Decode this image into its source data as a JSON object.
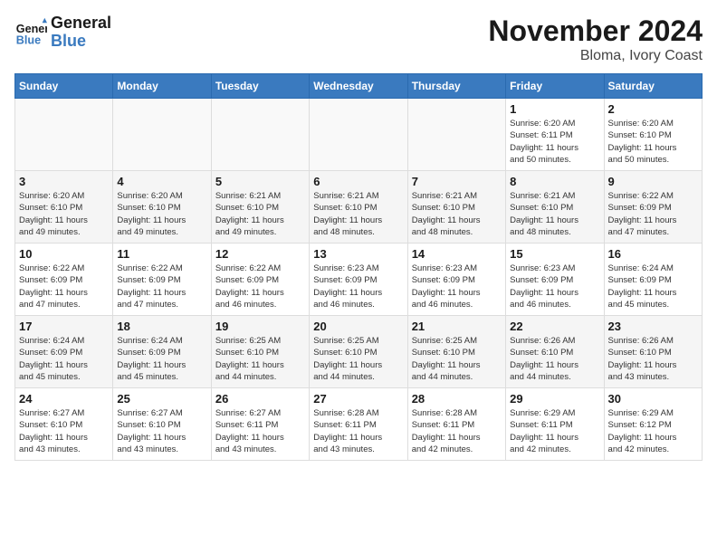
{
  "logo": {
    "text_general": "General",
    "text_blue": "Blue"
  },
  "title": "November 2024",
  "location": "Bloma, Ivory Coast",
  "weekdays": [
    "Sunday",
    "Monday",
    "Tuesday",
    "Wednesday",
    "Thursday",
    "Friday",
    "Saturday"
  ],
  "weeks": [
    [
      {
        "day": "",
        "info": ""
      },
      {
        "day": "",
        "info": ""
      },
      {
        "day": "",
        "info": ""
      },
      {
        "day": "",
        "info": ""
      },
      {
        "day": "",
        "info": ""
      },
      {
        "day": "1",
        "info": "Sunrise: 6:20 AM\nSunset: 6:11 PM\nDaylight: 11 hours\nand 50 minutes."
      },
      {
        "day": "2",
        "info": "Sunrise: 6:20 AM\nSunset: 6:10 PM\nDaylight: 11 hours\nand 50 minutes."
      }
    ],
    [
      {
        "day": "3",
        "info": "Sunrise: 6:20 AM\nSunset: 6:10 PM\nDaylight: 11 hours\nand 49 minutes."
      },
      {
        "day": "4",
        "info": "Sunrise: 6:20 AM\nSunset: 6:10 PM\nDaylight: 11 hours\nand 49 minutes."
      },
      {
        "day": "5",
        "info": "Sunrise: 6:21 AM\nSunset: 6:10 PM\nDaylight: 11 hours\nand 49 minutes."
      },
      {
        "day": "6",
        "info": "Sunrise: 6:21 AM\nSunset: 6:10 PM\nDaylight: 11 hours\nand 48 minutes."
      },
      {
        "day": "7",
        "info": "Sunrise: 6:21 AM\nSunset: 6:10 PM\nDaylight: 11 hours\nand 48 minutes."
      },
      {
        "day": "8",
        "info": "Sunrise: 6:21 AM\nSunset: 6:10 PM\nDaylight: 11 hours\nand 48 minutes."
      },
      {
        "day": "9",
        "info": "Sunrise: 6:22 AM\nSunset: 6:09 PM\nDaylight: 11 hours\nand 47 minutes."
      }
    ],
    [
      {
        "day": "10",
        "info": "Sunrise: 6:22 AM\nSunset: 6:09 PM\nDaylight: 11 hours\nand 47 minutes."
      },
      {
        "day": "11",
        "info": "Sunrise: 6:22 AM\nSunset: 6:09 PM\nDaylight: 11 hours\nand 47 minutes."
      },
      {
        "day": "12",
        "info": "Sunrise: 6:22 AM\nSunset: 6:09 PM\nDaylight: 11 hours\nand 46 minutes."
      },
      {
        "day": "13",
        "info": "Sunrise: 6:23 AM\nSunset: 6:09 PM\nDaylight: 11 hours\nand 46 minutes."
      },
      {
        "day": "14",
        "info": "Sunrise: 6:23 AM\nSunset: 6:09 PM\nDaylight: 11 hours\nand 46 minutes."
      },
      {
        "day": "15",
        "info": "Sunrise: 6:23 AM\nSunset: 6:09 PM\nDaylight: 11 hours\nand 46 minutes."
      },
      {
        "day": "16",
        "info": "Sunrise: 6:24 AM\nSunset: 6:09 PM\nDaylight: 11 hours\nand 45 minutes."
      }
    ],
    [
      {
        "day": "17",
        "info": "Sunrise: 6:24 AM\nSunset: 6:09 PM\nDaylight: 11 hours\nand 45 minutes."
      },
      {
        "day": "18",
        "info": "Sunrise: 6:24 AM\nSunset: 6:09 PM\nDaylight: 11 hours\nand 45 minutes."
      },
      {
        "day": "19",
        "info": "Sunrise: 6:25 AM\nSunset: 6:10 PM\nDaylight: 11 hours\nand 44 minutes."
      },
      {
        "day": "20",
        "info": "Sunrise: 6:25 AM\nSunset: 6:10 PM\nDaylight: 11 hours\nand 44 minutes."
      },
      {
        "day": "21",
        "info": "Sunrise: 6:25 AM\nSunset: 6:10 PM\nDaylight: 11 hours\nand 44 minutes."
      },
      {
        "day": "22",
        "info": "Sunrise: 6:26 AM\nSunset: 6:10 PM\nDaylight: 11 hours\nand 44 minutes."
      },
      {
        "day": "23",
        "info": "Sunrise: 6:26 AM\nSunset: 6:10 PM\nDaylight: 11 hours\nand 43 minutes."
      }
    ],
    [
      {
        "day": "24",
        "info": "Sunrise: 6:27 AM\nSunset: 6:10 PM\nDaylight: 11 hours\nand 43 minutes."
      },
      {
        "day": "25",
        "info": "Sunrise: 6:27 AM\nSunset: 6:10 PM\nDaylight: 11 hours\nand 43 minutes."
      },
      {
        "day": "26",
        "info": "Sunrise: 6:27 AM\nSunset: 6:11 PM\nDaylight: 11 hours\nand 43 minutes."
      },
      {
        "day": "27",
        "info": "Sunrise: 6:28 AM\nSunset: 6:11 PM\nDaylight: 11 hours\nand 43 minutes."
      },
      {
        "day": "28",
        "info": "Sunrise: 6:28 AM\nSunset: 6:11 PM\nDaylight: 11 hours\nand 42 minutes."
      },
      {
        "day": "29",
        "info": "Sunrise: 6:29 AM\nSunset: 6:11 PM\nDaylight: 11 hours\nand 42 minutes."
      },
      {
        "day": "30",
        "info": "Sunrise: 6:29 AM\nSunset: 6:12 PM\nDaylight: 11 hours\nand 42 minutes."
      }
    ]
  ]
}
